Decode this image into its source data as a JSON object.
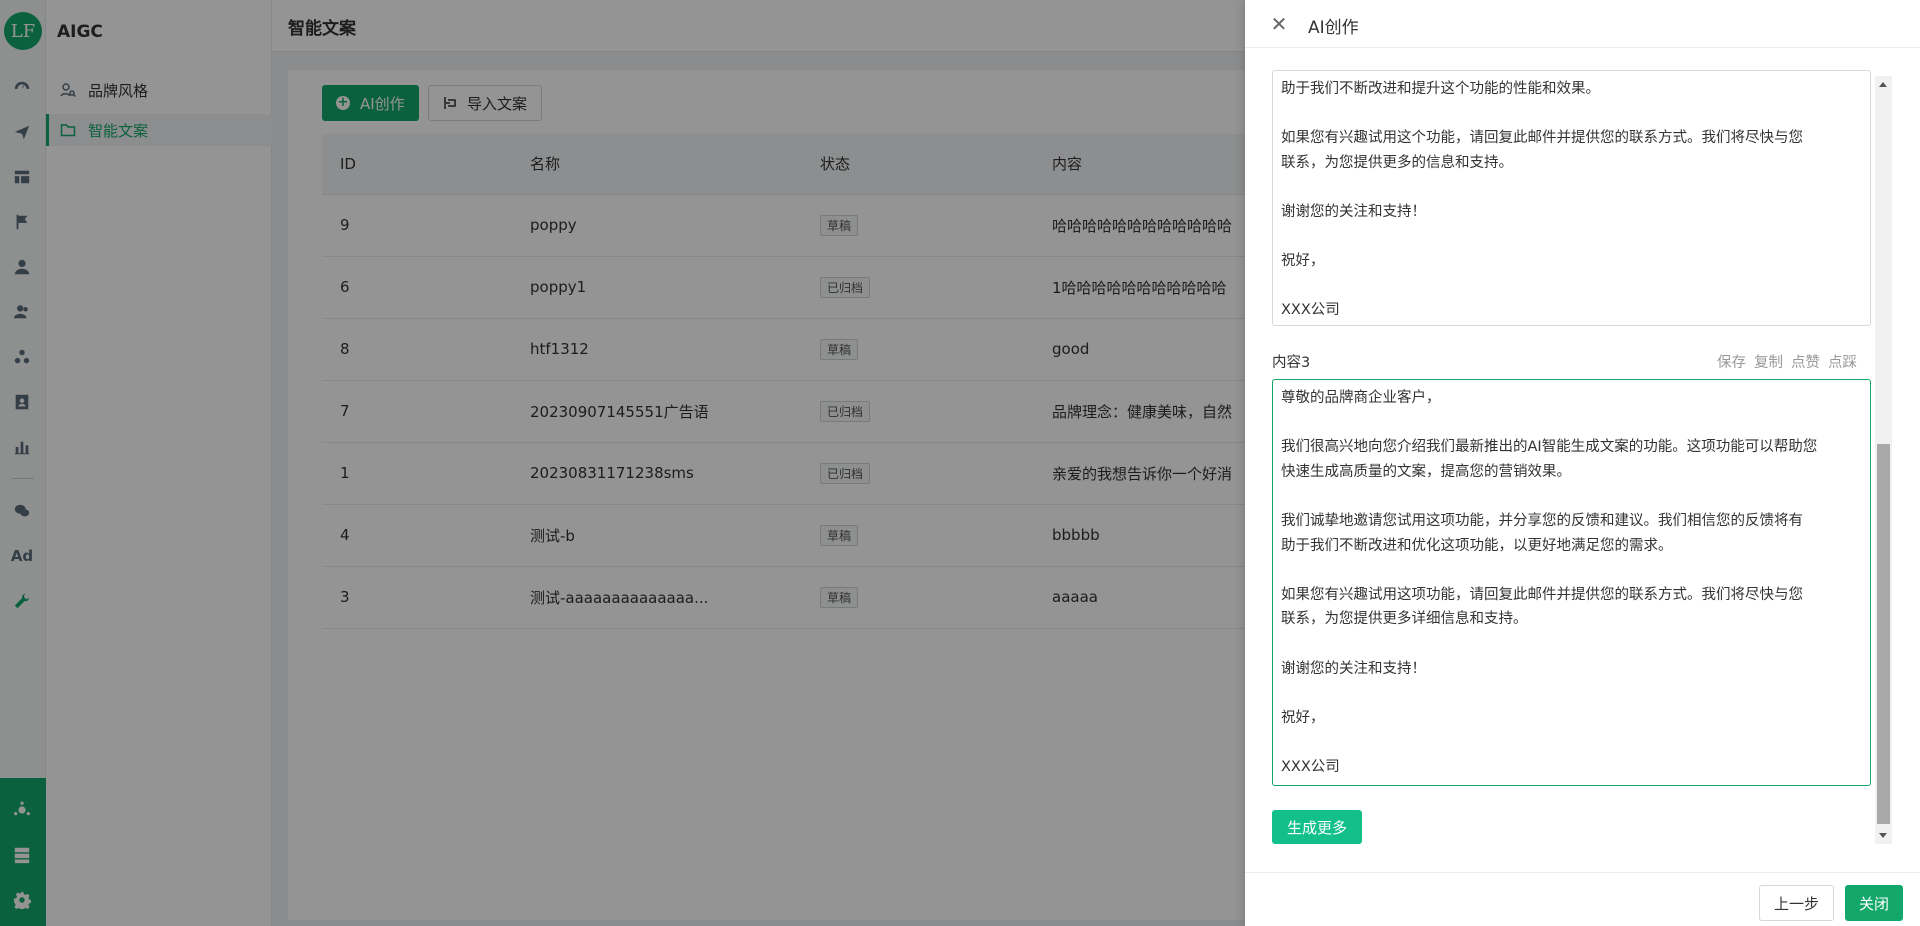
{
  "app": {
    "logo_text": "LF",
    "title": "AIGC"
  },
  "sidebar": {
    "items": [
      {
        "label": "品牌风格",
        "icon": "user-search-icon"
      },
      {
        "label": "智能文案",
        "icon": "folder-icon"
      }
    ]
  },
  "main": {
    "page_title": "智能文案",
    "ai_button": "AI创作",
    "import_button": "导入文案",
    "columns": [
      "ID",
      "名称",
      "状态",
      "内容"
    ],
    "rows": [
      {
        "id": "9",
        "name": "poppy",
        "status": "草稿",
        "content": "哈哈哈哈哈哈哈哈哈哈哈哈"
      },
      {
        "id": "6",
        "name": "poppy1",
        "status": "已归档",
        "content": "1哈哈哈哈哈哈哈哈哈哈哈"
      },
      {
        "id": "8",
        "name": "htf1312",
        "status": "草稿",
        "content": "good"
      },
      {
        "id": "7",
        "name": "20230907145551广告语",
        "status": "已归档",
        "content": "品牌理念：健康美味，自然"
      },
      {
        "id": "1",
        "name": "20230831171238sms",
        "status": "已归档",
        "content": "亲爱的我想告诉你一个好消"
      },
      {
        "id": "4",
        "name": "测试-b",
        "status": "草稿",
        "content": "bbbbb"
      },
      {
        "id": "3",
        "name": "测试-aaaaaaaaaaaaaa...",
        "status": "草稿",
        "content": "aaaaa"
      }
    ]
  },
  "drawer": {
    "title": "AI创作",
    "content2_lines": [
      "助于我们不断改进和提升这个功能的性能和效果。",
      "",
      "如果您有兴趣试用这个功能，请回复此邮件并提供您的联系方式。我们将尽快与您",
      "联系，为您提供更多的信息和支持。",
      "",
      "谢谢您的关注和支持！",
      "",
      "祝好，",
      "",
      "XXX公司"
    ],
    "content3_label": "内容3",
    "actions": [
      "保存",
      "复制",
      "点赞",
      "点踩"
    ],
    "content3_lines": [
      "尊敬的品牌商企业客户，",
      "",
      "我们很高兴地向您介绍我们最新推出的AI智能生成文案的功能。这项功能可以帮助您",
      "快速生成高质量的文案，提高您的营销效果。",
      "",
      "我们诚挚地邀请您试用这项功能，并分享您的反馈和建议。我们相信您的反馈将有",
      "助于我们不断改进和优化这项功能，以更好地满足您的需求。",
      "",
      "如果您有兴趣试用这项功能，请回复此邮件并提供您的联系方式。我们将尽快与您",
      "联系，为您提供更多详细信息和支持。",
      "",
      "谢谢您的关注和支持！",
      "",
      "祝好，",
      "",
      "XXX公司"
    ],
    "generate_more": "生成更多",
    "prev_button": "上一步",
    "close_button": "关闭"
  },
  "colors": {
    "primary": "#13a86a",
    "accent": "#13c08a"
  }
}
